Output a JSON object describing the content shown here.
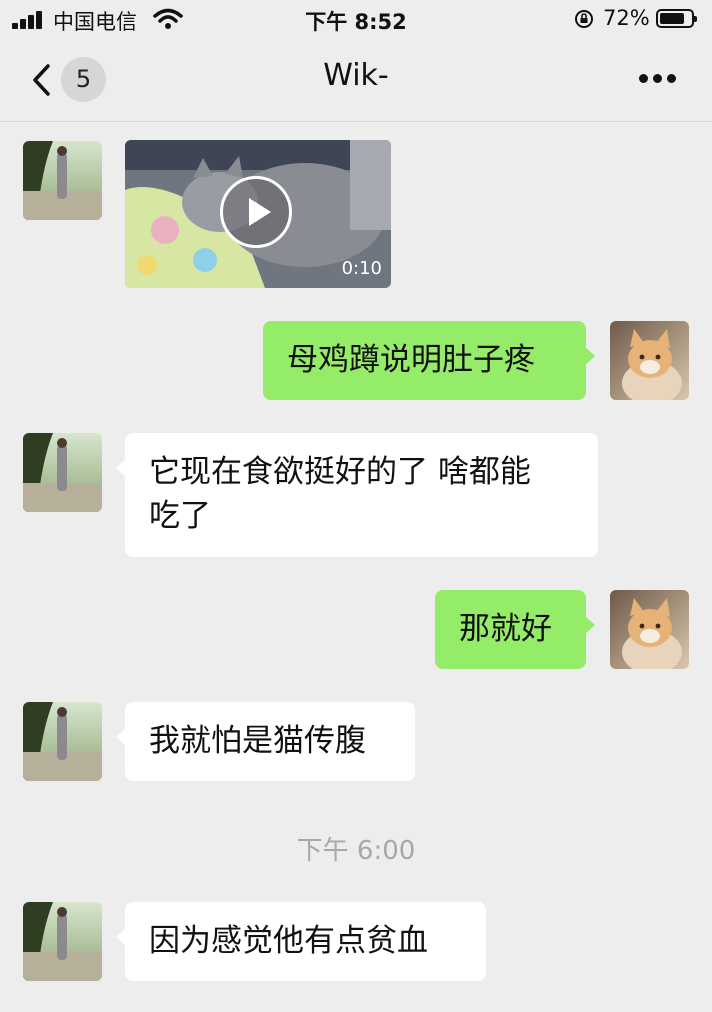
{
  "status": {
    "carrier": "中国电信",
    "time": "下午 8:52",
    "battery": "72%"
  },
  "header": {
    "unread_count": "5",
    "title": "Wik-"
  },
  "messages": {
    "video_duration": "0:10",
    "m1": "母鸡蹲说明肚子疼",
    "m2_line1": "它现在食欲挺好的了 啥都能",
    "m2_line2": "吃了",
    "m3": "那就好",
    "m4": "我就怕是猫传腹",
    "timestamp": "下午 6:00",
    "m5": "因为感觉他有点贫血"
  },
  "colors": {
    "background": "#ededed",
    "outgoing_bubble": "#95ec69",
    "incoming_bubble": "#ffffff"
  }
}
